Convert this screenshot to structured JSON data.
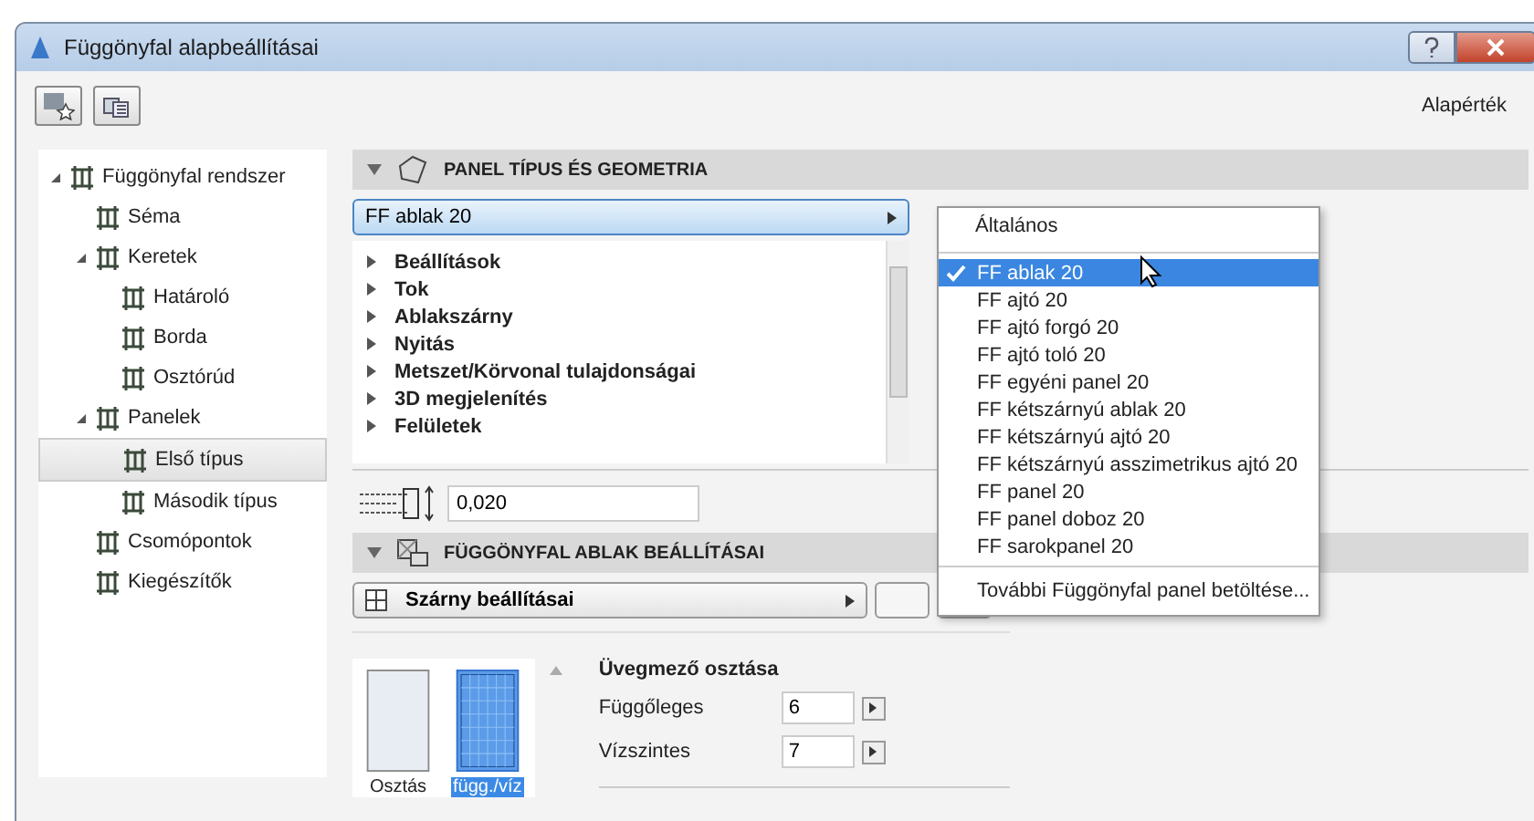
{
  "window": {
    "title": "Függönyfal alapbeállításai"
  },
  "toolbar": {
    "defaults_label": "Alapérték"
  },
  "tree": [
    {
      "label": "Függönyfal rendszer",
      "expanded": true,
      "selected": false,
      "children": [
        {
          "label": "Séma",
          "selected": false
        },
        {
          "label": "Keretek",
          "expanded": true,
          "selected": false,
          "children": [
            {
              "label": "Határoló",
              "selected": false
            },
            {
              "label": "Borda",
              "selected": false
            },
            {
              "label": "Osztórúd",
              "selected": false
            }
          ]
        },
        {
          "label": "Panelek",
          "expanded": true,
          "selected": false,
          "children": [
            {
              "label": "Első típus",
              "selected": true
            },
            {
              "label": "Második típus",
              "selected": false
            }
          ]
        },
        {
          "label": "Csomópontok",
          "selected": false
        },
        {
          "label": "Kiegészítők",
          "selected": false
        }
      ]
    }
  ],
  "panel_section": {
    "title": "PANEL TÍPUS ÉS GEOMETRIA",
    "expanded": true,
    "selected_type": "FF ablak 20",
    "settings": [
      "Beállítások",
      "Tok",
      "Ablakszárny",
      "Nyitás",
      "Metszet/Körvonal tulajdonságai",
      "3D megjelenítés",
      "Felületek"
    ],
    "offset_value": "0,020"
  },
  "window_section": {
    "title": "FÜGGÖNYFAL ABLAK BEÁLLÍTÁSAI",
    "expanded": true,
    "page_dropdown": "Szárny beállításai",
    "thumbnails": [
      {
        "label": "Osztás",
        "selected": false
      },
      {
        "label": "függ./víz",
        "selected": true
      }
    ],
    "glass_division": {
      "title": "Üvegmező osztása",
      "fields": [
        {
          "label": "Függőleges",
          "value": "6"
        },
        {
          "label": "Vízszintes",
          "value": "7"
        }
      ]
    }
  },
  "popup_menu": {
    "header": "Általános",
    "items": [
      {
        "label": "FF ablak 20",
        "selected": true
      },
      {
        "label": "FF ajtó 20",
        "selected": false
      },
      {
        "label": "FF ajtó forgó 20",
        "selected": false
      },
      {
        "label": "FF ajtó toló 20",
        "selected": false
      },
      {
        "label": "FF egyéni panel 20",
        "selected": false
      },
      {
        "label": "FF kétszárnyú ablak 20",
        "selected": false
      },
      {
        "label": "FF kétszárnyú ajtó 20",
        "selected": false
      },
      {
        "label": "FF kétszárnyú asszimetrikus ajtó 20",
        "selected": false
      },
      {
        "label": "FF panel 20",
        "selected": false
      },
      {
        "label": "FF panel doboz 20",
        "selected": false
      },
      {
        "label": "FF sarokpanel 20",
        "selected": false
      }
    ],
    "footer": "További Függönyfal panel betöltése..."
  }
}
